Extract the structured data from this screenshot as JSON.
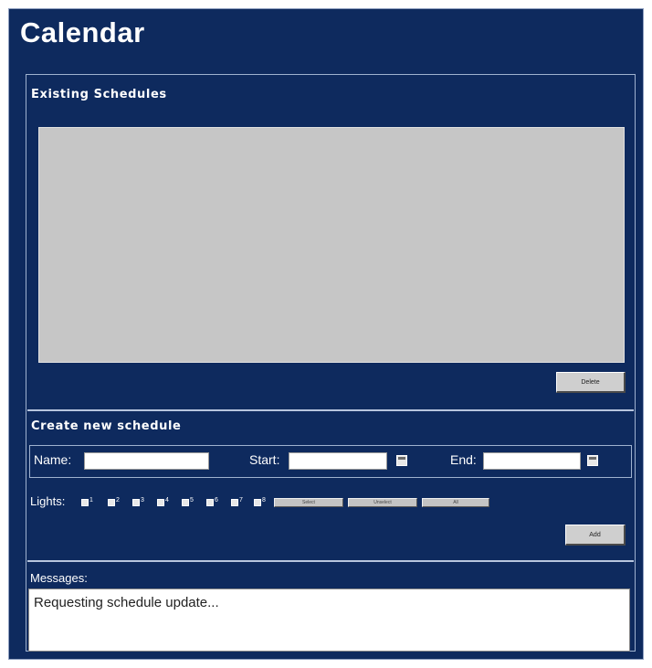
{
  "app": {
    "title": "Calendar"
  },
  "existing": {
    "title": "Existing Schedules",
    "delete_label": "Delete"
  },
  "create": {
    "title": "Create new schedule",
    "name_label": "Name:",
    "name_value": "",
    "start_label": "Start:",
    "start_value": "",
    "end_label": "End:",
    "end_value": "",
    "lights_label": "Lights:",
    "lights": [
      "1",
      "2",
      "3",
      "4",
      "5",
      "6",
      "7",
      "8"
    ],
    "select_all_label": "Select",
    "unselect_label": "Unselect",
    "invert_label": "All",
    "add_label": "Add"
  },
  "messages": {
    "label": "Messages:",
    "text": "Requesting schedule update..."
  },
  "colors": {
    "background": "#0e2a5e",
    "list_gray": "#c6c6c6",
    "button_gray": "#cfcfcf"
  }
}
